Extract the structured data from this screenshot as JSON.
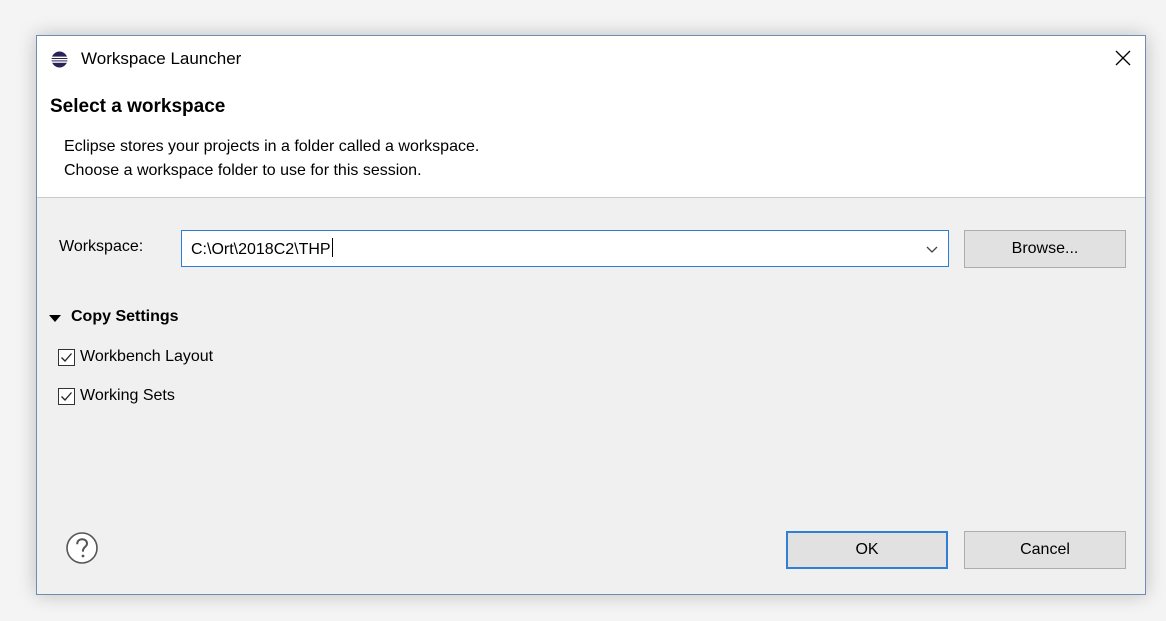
{
  "window": {
    "title": "Workspace Launcher"
  },
  "header": {
    "title": "Select a workspace",
    "description_line1": "Eclipse stores your projects in a folder called a workspace.",
    "description_line2": "Choose a workspace folder to use for this session."
  },
  "workspace": {
    "label": "Workspace:",
    "value": "C:\\Ort\\2018C2\\THP",
    "browse_label": "Browse..."
  },
  "copy_settings": {
    "label": "Copy Settings",
    "expanded": true,
    "options": [
      {
        "label": "Workbench Layout",
        "checked": true
      },
      {
        "label": "Working Sets",
        "checked": true
      }
    ]
  },
  "footer": {
    "ok_label": "OK",
    "cancel_label": "Cancel"
  },
  "icons": {
    "app": "eclipse-icon",
    "close": "close-icon",
    "dropdown": "chevron-down-icon",
    "help": "help-icon",
    "expand": "triangle-down-icon",
    "check": "checkmark-icon"
  },
  "colors": {
    "focus_border": "#2a7fd4",
    "window_border": "#6f8cb3",
    "eclipse_purple": "#2c2255"
  }
}
